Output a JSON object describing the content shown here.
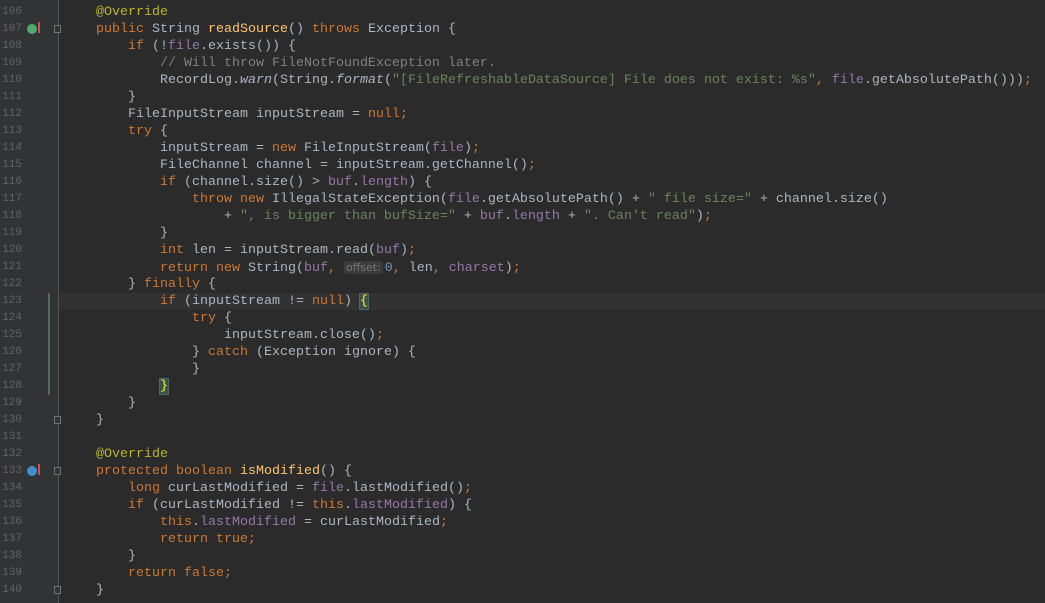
{
  "editor": {
    "theme_colors": {
      "background": "#2b2b2b",
      "keyword": "#cc7832",
      "string": "#6a8759",
      "field": "#9876aa",
      "annotation": "#bbb529",
      "method": "#ffc66d",
      "comment": "#808080",
      "number": "#6897bb"
    },
    "current_line": 123,
    "gutter_icons": [
      {
        "line": 107,
        "icon": "override-method-icon"
      },
      {
        "line": 133,
        "icon": "override-method-icon"
      }
    ],
    "fold_markers": [
      107,
      130,
      133,
      140
    ],
    "lines": [
      {
        "n": "106",
        "t": [
          [
            "p",
            "    "
          ],
          [
            "a",
            "@Override"
          ]
        ]
      },
      {
        "n": "107",
        "t": [
          [
            "p",
            "    "
          ],
          [
            "k",
            "public "
          ],
          [
            "p",
            "String "
          ],
          [
            "m",
            "readSource"
          ],
          [
            "p",
            "() "
          ],
          [
            "k",
            "throws "
          ],
          [
            "p",
            "Exception {"
          ]
        ]
      },
      {
        "n": "108",
        "t": [
          [
            "p",
            "        "
          ],
          [
            "k",
            "if "
          ],
          [
            "p",
            "(!"
          ],
          [
            "f",
            "file"
          ],
          [
            "p",
            ".exists()) {"
          ]
        ]
      },
      {
        "n": "109",
        "t": [
          [
            "p",
            "            "
          ],
          [
            "c",
            "// Will throw FileNotFoundException later."
          ]
        ]
      },
      {
        "n": "110",
        "t": [
          [
            "p",
            "            RecordLog."
          ],
          [
            "fi",
            "warn"
          ],
          [
            "p",
            "(String."
          ],
          [
            "fi",
            "format"
          ],
          [
            "p",
            "("
          ],
          [
            "s",
            "\"[FileRefreshableDataSource] File does not exist: %s\""
          ],
          [
            "p",
            ", "
          ],
          [
            "f",
            "file"
          ],
          [
            "p",
            ".getAbsolutePath()));"
          ]
        ]
      },
      {
        "n": "111",
        "t": [
          [
            "p",
            "        }"
          ]
        ]
      },
      {
        "n": "112",
        "t": [
          [
            "p",
            "        FileInputStream inputStream = "
          ],
          [
            "k",
            "null"
          ],
          [
            "p",
            ";"
          ]
        ]
      },
      {
        "n": "113",
        "t": [
          [
            "p",
            "        "
          ],
          [
            "k",
            "try "
          ],
          [
            "p",
            "{"
          ]
        ]
      },
      {
        "n": "114",
        "t": [
          [
            "p",
            "            inputStream = "
          ],
          [
            "k",
            "new "
          ],
          [
            "p",
            "FileInputStream("
          ],
          [
            "f",
            "file"
          ],
          [
            "p",
            ");"
          ]
        ]
      },
      {
        "n": "115",
        "t": [
          [
            "p",
            "            FileChannel channel = inputStream.getChannel();"
          ]
        ]
      },
      {
        "n": "116",
        "t": [
          [
            "p",
            "            "
          ],
          [
            "k",
            "if "
          ],
          [
            "p",
            "(channel.size() > "
          ],
          [
            "f",
            "buf"
          ],
          [
            "p",
            "."
          ],
          [
            "f",
            "length"
          ],
          [
            "p",
            ") {"
          ]
        ]
      },
      {
        "n": "117",
        "t": [
          [
            "p",
            "                "
          ],
          [
            "k",
            "throw new "
          ],
          [
            "p",
            "IllegalStateException("
          ],
          [
            "f",
            "file"
          ],
          [
            "p",
            ".getAbsolutePath() + "
          ],
          [
            "s",
            "\" file size=\""
          ],
          [
            "p",
            " + channel.size()"
          ]
        ]
      },
      {
        "n": "118",
        "t": [
          [
            "p",
            "                    + "
          ],
          [
            "s",
            "\", is bigger than bufSize=\""
          ],
          [
            "p",
            " + "
          ],
          [
            "f",
            "buf"
          ],
          [
            "p",
            "."
          ],
          [
            "f",
            "length"
          ],
          [
            "p",
            " + "
          ],
          [
            "s",
            "\". Can't read\""
          ],
          [
            "p",
            ");"
          ]
        ]
      },
      {
        "n": "119",
        "t": [
          [
            "p",
            "            }"
          ]
        ]
      },
      {
        "n": "120",
        "t": [
          [
            "p",
            "            "
          ],
          [
            "k",
            "int "
          ],
          [
            "p",
            "len = inputStream.read("
          ],
          [
            "f",
            "buf"
          ],
          [
            "p",
            ");"
          ]
        ]
      },
      {
        "n": "121",
        "t": [
          [
            "p",
            "            "
          ],
          [
            "k",
            "return new "
          ],
          [
            "p",
            "String("
          ],
          [
            "f",
            "buf"
          ],
          [
            "p",
            ", "
          ],
          [
            "h",
            "offset:"
          ],
          [
            "n",
            "0"
          ],
          [
            "p",
            ", len, "
          ],
          [
            "f",
            "charset"
          ],
          [
            "p",
            ");"
          ]
        ]
      },
      {
        "n": "122",
        "t": [
          [
            "p",
            "        } "
          ],
          [
            "k",
            "finally "
          ],
          [
            "p",
            "{"
          ]
        ]
      },
      {
        "n": "123",
        "t": [
          [
            "p",
            "            "
          ],
          [
            "k",
            "if "
          ],
          [
            "p",
            "(inputStream != "
          ],
          [
            "k",
            "null"
          ],
          [
            "p",
            ") "
          ],
          [
            "b",
            "{"
          ]
        ]
      },
      {
        "n": "124",
        "t": [
          [
            "p",
            "                "
          ],
          [
            "k",
            "try "
          ],
          [
            "p",
            "{"
          ]
        ]
      },
      {
        "n": "125",
        "t": [
          [
            "p",
            "                    inputStream.close();"
          ]
        ]
      },
      {
        "n": "126",
        "t": [
          [
            "p",
            "                } "
          ],
          [
            "k",
            "catch "
          ],
          [
            "p",
            "(Exception ignore) {"
          ]
        ]
      },
      {
        "n": "127",
        "t": [
          [
            "p",
            "                }"
          ]
        ]
      },
      {
        "n": "128",
        "t": [
          [
            "p",
            "            "
          ],
          [
            "b",
            "}"
          ]
        ]
      },
      {
        "n": "129",
        "t": [
          [
            "p",
            "        }"
          ]
        ]
      },
      {
        "n": "130",
        "t": [
          [
            "p",
            "    }"
          ]
        ]
      },
      {
        "n": "131",
        "t": []
      },
      {
        "n": "132",
        "t": [
          [
            "p",
            "    "
          ],
          [
            "a",
            "@Override"
          ]
        ]
      },
      {
        "n": "133",
        "t": [
          [
            "p",
            "    "
          ],
          [
            "k",
            "protected boolean "
          ],
          [
            "m",
            "isModified"
          ],
          [
            "p",
            "() {"
          ]
        ]
      },
      {
        "n": "134",
        "t": [
          [
            "p",
            "        "
          ],
          [
            "k",
            "long "
          ],
          [
            "p",
            "curLastModified = "
          ],
          [
            "f",
            "file"
          ],
          [
            "p",
            ".lastModified();"
          ]
        ]
      },
      {
        "n": "135",
        "t": [
          [
            "p",
            "        "
          ],
          [
            "k",
            "if "
          ],
          [
            "p",
            "(curLastModified != "
          ],
          [
            "k",
            "this"
          ],
          [
            "p",
            "."
          ],
          [
            "f",
            "lastModified"
          ],
          [
            "p",
            ") {"
          ]
        ]
      },
      {
        "n": "136",
        "t": [
          [
            "p",
            "            "
          ],
          [
            "k",
            "this"
          ],
          [
            "p",
            "."
          ],
          [
            "f",
            "lastModified"
          ],
          [
            "p",
            " = curLastModified;"
          ]
        ]
      },
      {
        "n": "137",
        "t": [
          [
            "p",
            "            "
          ],
          [
            "k",
            "return true"
          ],
          [
            "p",
            ";"
          ]
        ]
      },
      {
        "n": "138",
        "t": [
          [
            "p",
            "        }"
          ]
        ]
      },
      {
        "n": "139",
        "t": [
          [
            "p",
            "        "
          ],
          [
            "k",
            "return false"
          ],
          [
            "p",
            ";"
          ]
        ]
      },
      {
        "n": "140",
        "t": [
          [
            "p",
            "    }"
          ]
        ]
      }
    ]
  }
}
